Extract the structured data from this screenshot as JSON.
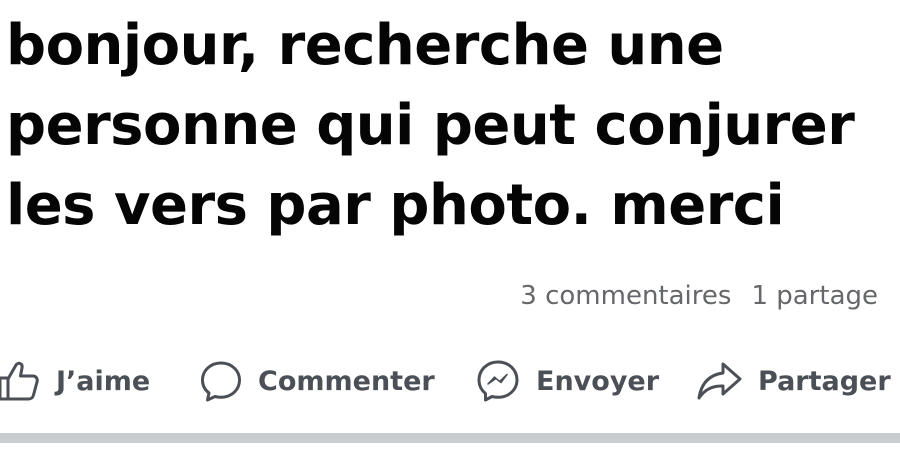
{
  "post": {
    "text_lines": [
      "bonjour, recherche une",
      "personne qui peut conjurer",
      "les vers par photo. merci"
    ]
  },
  "stats": {
    "comments": "3 commentaires",
    "shares": "1 partage"
  },
  "actions": {
    "like": {
      "label": "J’aime",
      "icon": "thumbs-up-icon"
    },
    "comment": {
      "label": "Commenter",
      "icon": "speech-bubble-icon"
    },
    "send": {
      "label": "Envoyer",
      "icon": "messenger-icon"
    },
    "share": {
      "label": "Partager",
      "icon": "share-arrow-icon"
    }
  },
  "colors": {
    "text": "#050505",
    "secondary": "#65676b",
    "action": "#4b4f56",
    "separator": "#c9ccd1"
  }
}
